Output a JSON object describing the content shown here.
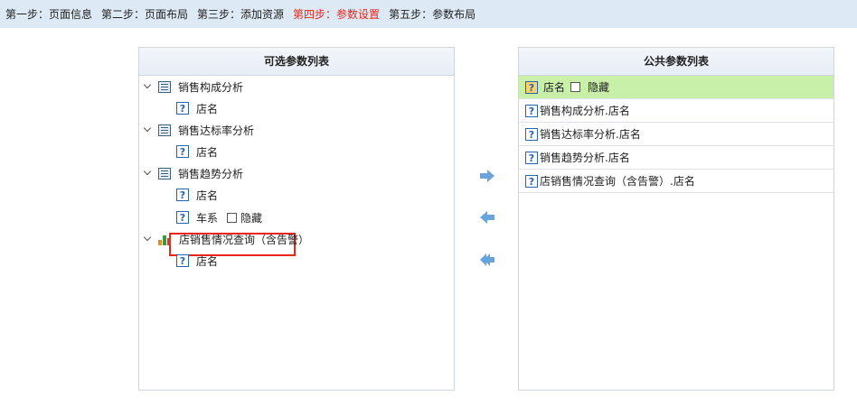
{
  "steps": [
    {
      "label": "第一步：页面信息",
      "active": false
    },
    {
      "label": "第二步：页面布局",
      "active": false
    },
    {
      "label": "第三步：添加资源",
      "active": false
    },
    {
      "label": "第四步：参数设置",
      "active": true
    },
    {
      "label": "第五步：参数布局",
      "active": false
    }
  ],
  "left_panel": {
    "title": "可选参数列表",
    "tree": [
      {
        "label": "销售构成分析",
        "icon": "report-icon",
        "children": [
          {
            "label": "店名"
          }
        ]
      },
      {
        "label": "销售达标率分析",
        "icon": "report-icon",
        "children": [
          {
            "label": "店名"
          }
        ]
      },
      {
        "label": "销售趋势分析",
        "icon": "report-icon",
        "children": [
          {
            "label": "店名"
          },
          {
            "label": "车系",
            "hide_label": "隐藏"
          }
        ]
      },
      {
        "label": "店销售情况查询（含告警）",
        "icon": "bar-chart-icon",
        "children": [
          {
            "label": "店名"
          }
        ]
      }
    ]
  },
  "right_panel": {
    "title": "公共参数列表",
    "selected_row": {
      "label": "店名",
      "hide_label": "隐藏"
    },
    "rows": [
      "销售构成分析.店名",
      "销售达标率分析.店名",
      "销售趋势分析.店名",
      "店销售情况查询（含告警）.店名"
    ]
  },
  "icons": {
    "arrow_right": "arrow-right-icon",
    "arrow_left": "arrow-left-icon",
    "arrow_all_left": "double-arrow-left-icon",
    "question": "?"
  },
  "colors": {
    "active_step": "#e8261a",
    "selected_row": "#c8f0a8",
    "arrow": "#6aa4dc"
  }
}
